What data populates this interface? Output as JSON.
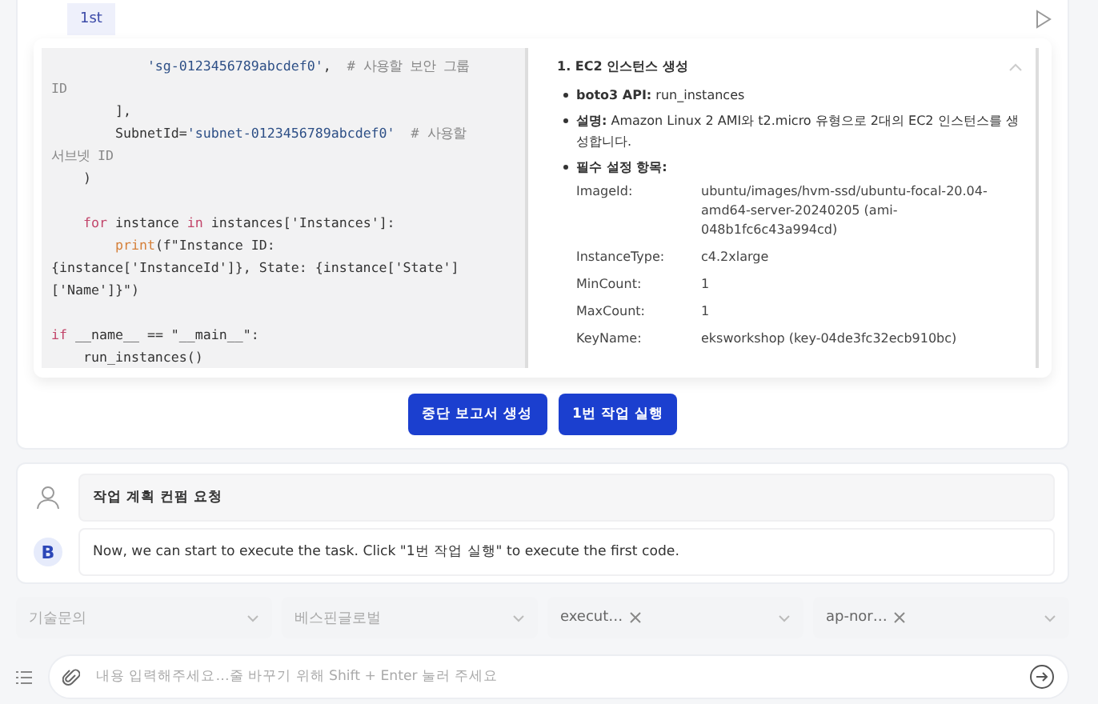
{
  "tag": "1st",
  "code": [
    [
      {
        "kind": "string",
        "text": "            'sg-0123456789abcdef0'"
      },
      {
        "kind": "plain",
        "text": ",  "
      },
      {
        "kind": "comment",
        "text": "# 사용할 보안 그룹"
      }
    ],
    [
      {
        "kind": "comment",
        "text": "ID"
      }
    ],
    [
      {
        "kind": "plain",
        "text": "        ],"
      }
    ],
    [
      {
        "kind": "plain",
        "text": "        SubnetId="
      },
      {
        "kind": "string",
        "text": "'subnet-0123456789abcdef0'"
      },
      {
        "kind": "comment",
        "text": "  # 사용할"
      }
    ],
    [
      {
        "kind": "comment",
        "text": "서브넷 ID"
      }
    ],
    [
      {
        "kind": "plain",
        "text": "    )"
      }
    ],
    [
      {
        "kind": "blank"
      }
    ],
    [
      {
        "kind": "keyword",
        "text": "    for"
      },
      {
        "kind": "plain",
        "text": " instance "
      },
      {
        "kind": "keyword",
        "text": "in"
      },
      {
        "kind": "plain",
        "text": " instances['Instances']:"
      }
    ],
    [
      {
        "kind": "builtin",
        "text": "        print"
      },
      {
        "kind": "plain",
        "text": "(f\"Instance ID:"
      }
    ],
    [
      {
        "kind": "plain",
        "text": "{instance['InstanceId']}, State: {instance['State']"
      }
    ],
    [
      {
        "kind": "plain",
        "text": "['Name']}\")"
      }
    ],
    [
      {
        "kind": "blank"
      }
    ],
    [
      {
        "kind": "keyword",
        "text": "if"
      },
      {
        "kind": "plain",
        "text": " __name__ == \"__main__\":"
      }
    ],
    [
      {
        "kind": "plain",
        "text": "    run_instances()"
      }
    ]
  ],
  "detail": {
    "title": "1. EC2 인스턴스 생성",
    "expanded": true,
    "bullets": [
      "**boto3 API:** run_instances",
      "**설명:** Amazon Linux 2 AMI와 t2.micro 유형으로 2대의 EC2 인스턴스를 생성합니다.",
      "**필수 설정 항목:**"
    ],
    "fields": [
      {
        "key": "ImageId:",
        "value": "ubuntu/images/hvm-ssd/ubuntu-focal-20.04-amd64-server-20240205 (ami-048b1fc6c43a994cd)"
      },
      {
        "key": "InstanceType:",
        "value": "c4.2xlarge"
      },
      {
        "key": "MinCount:",
        "value": "1"
      },
      {
        "key": "MaxCount:",
        "value": "1"
      },
      {
        "key": "KeyName:",
        "value": "eksworkshop (key-04de3fc32ecb910bc)"
      }
    ]
  },
  "actions": [
    "중단 보고서 생성",
    "1번 작업 실행"
  ],
  "messages": [
    {
      "kind": "user",
      "text": "작업 계획 컨펌 요청"
    },
    {
      "kind": "bot",
      "avatar": "B",
      "text": "Now, we can start to execute the task. Click \"1번 작업 실행\" to execute the first code."
    }
  ],
  "filters": [
    {
      "kind": "placeholder",
      "text": "기술문의"
    },
    {
      "kind": "placeholder",
      "text": "베스핀글로벌"
    },
    {
      "kind": "chip",
      "text": "execut…"
    },
    {
      "kind": "chip",
      "text": "ap-nor…"
    }
  ],
  "input": {
    "placeholder": "내용 입력해주세요…줄 바꾸기 위해 Shift + Enter 눌러 주세요"
  }
}
